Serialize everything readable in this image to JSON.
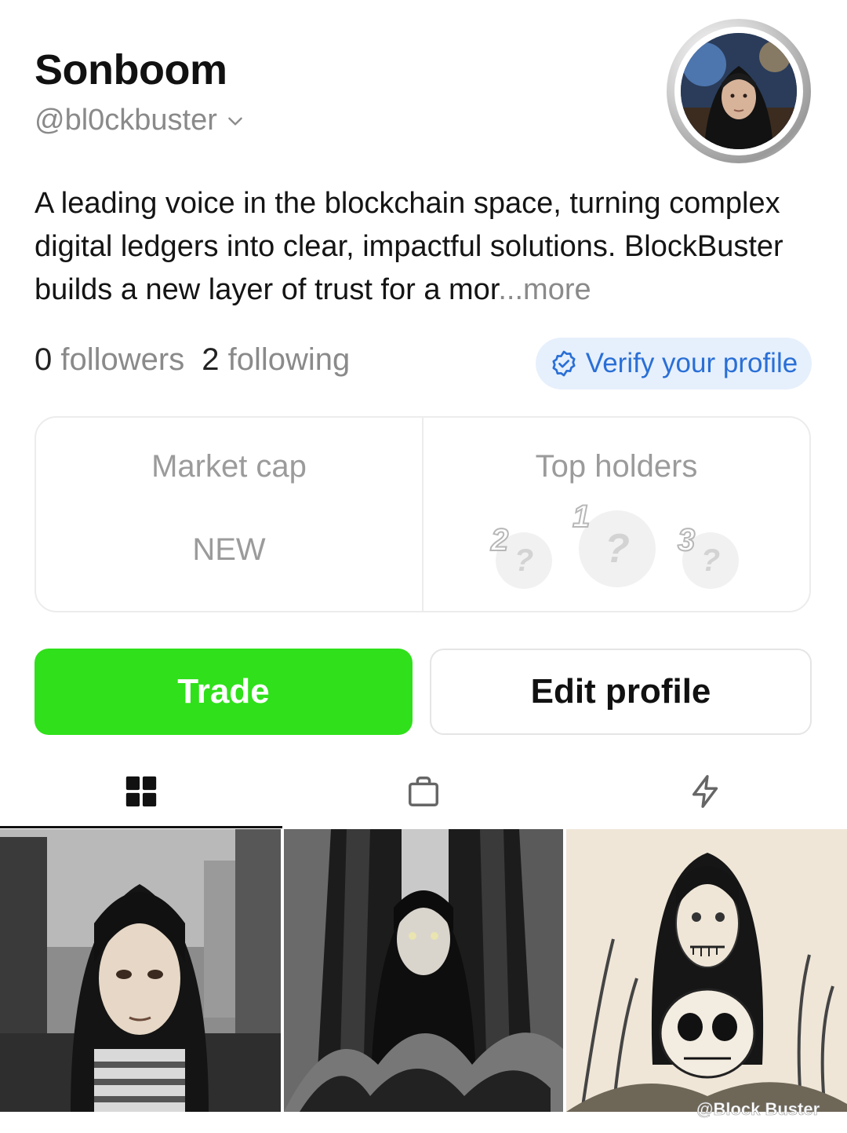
{
  "profile": {
    "name": "Sonboom",
    "handle": "@bl0ckbuster",
    "bio": "A leading voice in the blockchain space, turning complex digital ledgers into clear, impactful solutions. BlockBuster builds a new layer of trust for a mor",
    "bio_more": "...more"
  },
  "stats": {
    "followers_count": "0",
    "followers_label": "followers",
    "following_count": "2",
    "following_label": "following"
  },
  "verify": {
    "label": "Verify your profile",
    "icon": "verified-badge-icon",
    "color": "#2a6fd6"
  },
  "market_card": {
    "market_cap_label": "Market cap",
    "market_cap_value": "NEW",
    "top_holders_label": "Top holders",
    "holders": [
      {
        "rank": "1",
        "placeholder": "?"
      },
      {
        "rank": "2",
        "placeholder": "?"
      },
      {
        "rank": "3",
        "placeholder": "?"
      }
    ]
  },
  "actions": {
    "trade_label": "Trade",
    "trade_color": "#2fe01a",
    "edit_label": "Edit profile"
  },
  "tabs": [
    {
      "icon": "grid-icon",
      "selected": true
    },
    {
      "icon": "shopping-bag-icon",
      "selected": false
    },
    {
      "icon": "lightning-icon",
      "selected": false
    }
  ],
  "watermark": "@Block Buster"
}
